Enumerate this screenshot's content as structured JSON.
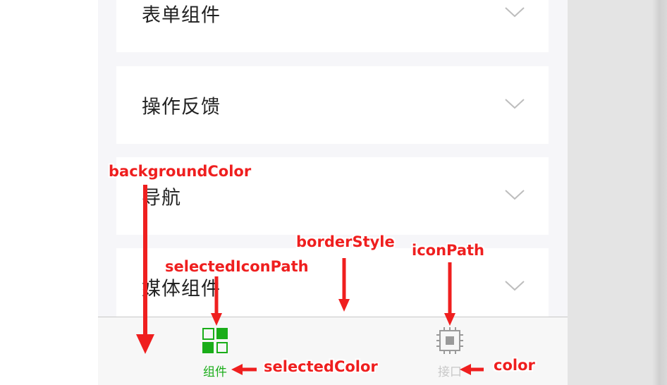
{
  "menu": {
    "items": [
      {
        "label": "表单组件"
      },
      {
        "label": "操作反馈"
      },
      {
        "label": "导航"
      },
      {
        "label": "媒体组件"
      }
    ]
  },
  "tabbar": {
    "tabs": [
      {
        "label": "组件",
        "selected": true,
        "icon": "grid-icon"
      },
      {
        "label": "接口",
        "selected": false,
        "icon": "chip-icon"
      }
    ],
    "selected_color": "#1aad19",
    "color": "#c8c8c8",
    "background_color": "#f7f7f7",
    "border_color": "#c8c8c8"
  },
  "annotations": {
    "background_color": "backgroundColor",
    "border_style": "borderStyle",
    "icon_path": "iconPath",
    "selected_icon_path": "selectedIconPath",
    "selected_color": "selectedColor",
    "color": "color"
  },
  "colors": {
    "annotation": "#ef1f1f",
    "page_bg": "#f6f6f9"
  }
}
